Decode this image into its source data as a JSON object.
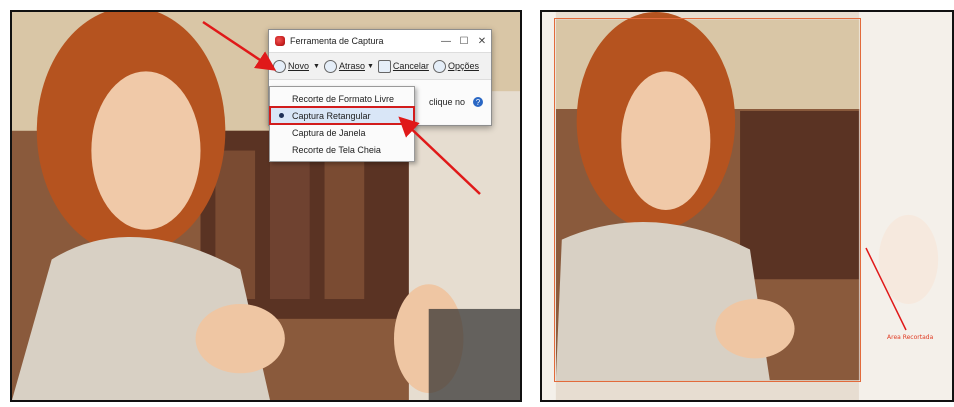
{
  "snipping_tool": {
    "title": "Ferramenta de Captura",
    "minimize": "—",
    "maximize": "☐",
    "close": "✕",
    "toolbar": {
      "new_label": "Novo",
      "delay_label": "Atraso",
      "cancel_label": "Cancelar",
      "options_label": "Opções"
    },
    "body_text": "clique no"
  },
  "dropdown": {
    "items": [
      {
        "label": "Recorte de Formato Livre"
      },
      {
        "label": "Captura Retangular"
      },
      {
        "label": "Captura de Janela"
      },
      {
        "label": "Recorte de Tela Cheia"
      }
    ]
  },
  "right_panel": {
    "annotation_label": "Area Recortada"
  },
  "colors": {
    "arrow": "#e01919",
    "highlight_border": "#d21c1c",
    "selection_border": "#e26a3b"
  }
}
